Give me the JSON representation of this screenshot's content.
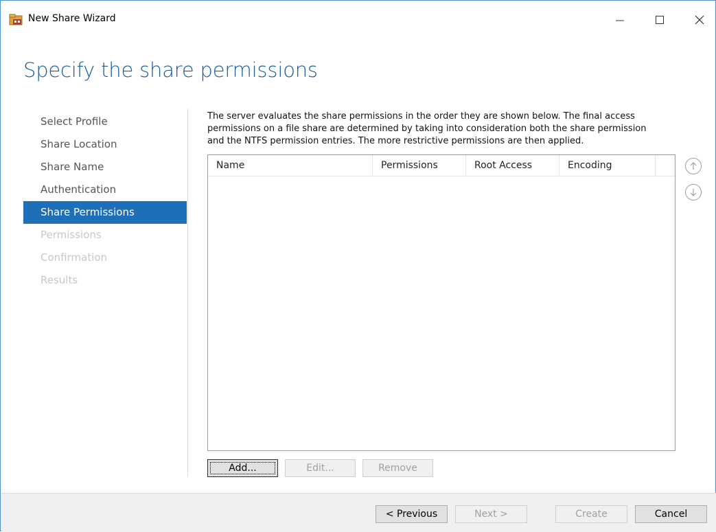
{
  "window": {
    "title": "New Share Wizard",
    "icons": {
      "app": "share-folder-icon",
      "minimize": "minimize-icon",
      "maximize": "maximize-icon",
      "close": "close-icon"
    }
  },
  "page": {
    "title": "Specify the share permissions"
  },
  "nav": {
    "items": [
      {
        "label": "Select Profile",
        "state": "normal"
      },
      {
        "label": "Share Location",
        "state": "normal"
      },
      {
        "label": "Share Name",
        "state": "normal"
      },
      {
        "label": "Authentication",
        "state": "normal"
      },
      {
        "label": "Share Permissions",
        "state": "active"
      },
      {
        "label": "Permissions",
        "state": "disabled"
      },
      {
        "label": "Confirmation",
        "state": "disabled"
      },
      {
        "label": "Results",
        "state": "disabled"
      }
    ]
  },
  "main": {
    "description_lines": [
      "The server evaluates the share permissions in the order they are shown below. The final access",
      "permissions on a file share are determined by taking into consideration both the share permission",
      "and the NTFS permission entries. The more restrictive permissions are then applied."
    ],
    "columns": [
      "Name",
      "Permissions",
      "Root Access",
      "Encoding"
    ],
    "rows": [],
    "move_up_icon": "arrow-up-circle-icon",
    "move_down_icon": "arrow-down-circle-icon",
    "buttons": {
      "add": "Add...",
      "edit": "Edit...",
      "remove": "Remove"
    }
  },
  "footer": {
    "previous": "< Previous",
    "next": "Next >",
    "create": "Create",
    "cancel": "Cancel"
  },
  "colors": {
    "accent": "#1e6fb8",
    "title": "#1a5b9c",
    "disabled_text": "#c8c8c8"
  }
}
